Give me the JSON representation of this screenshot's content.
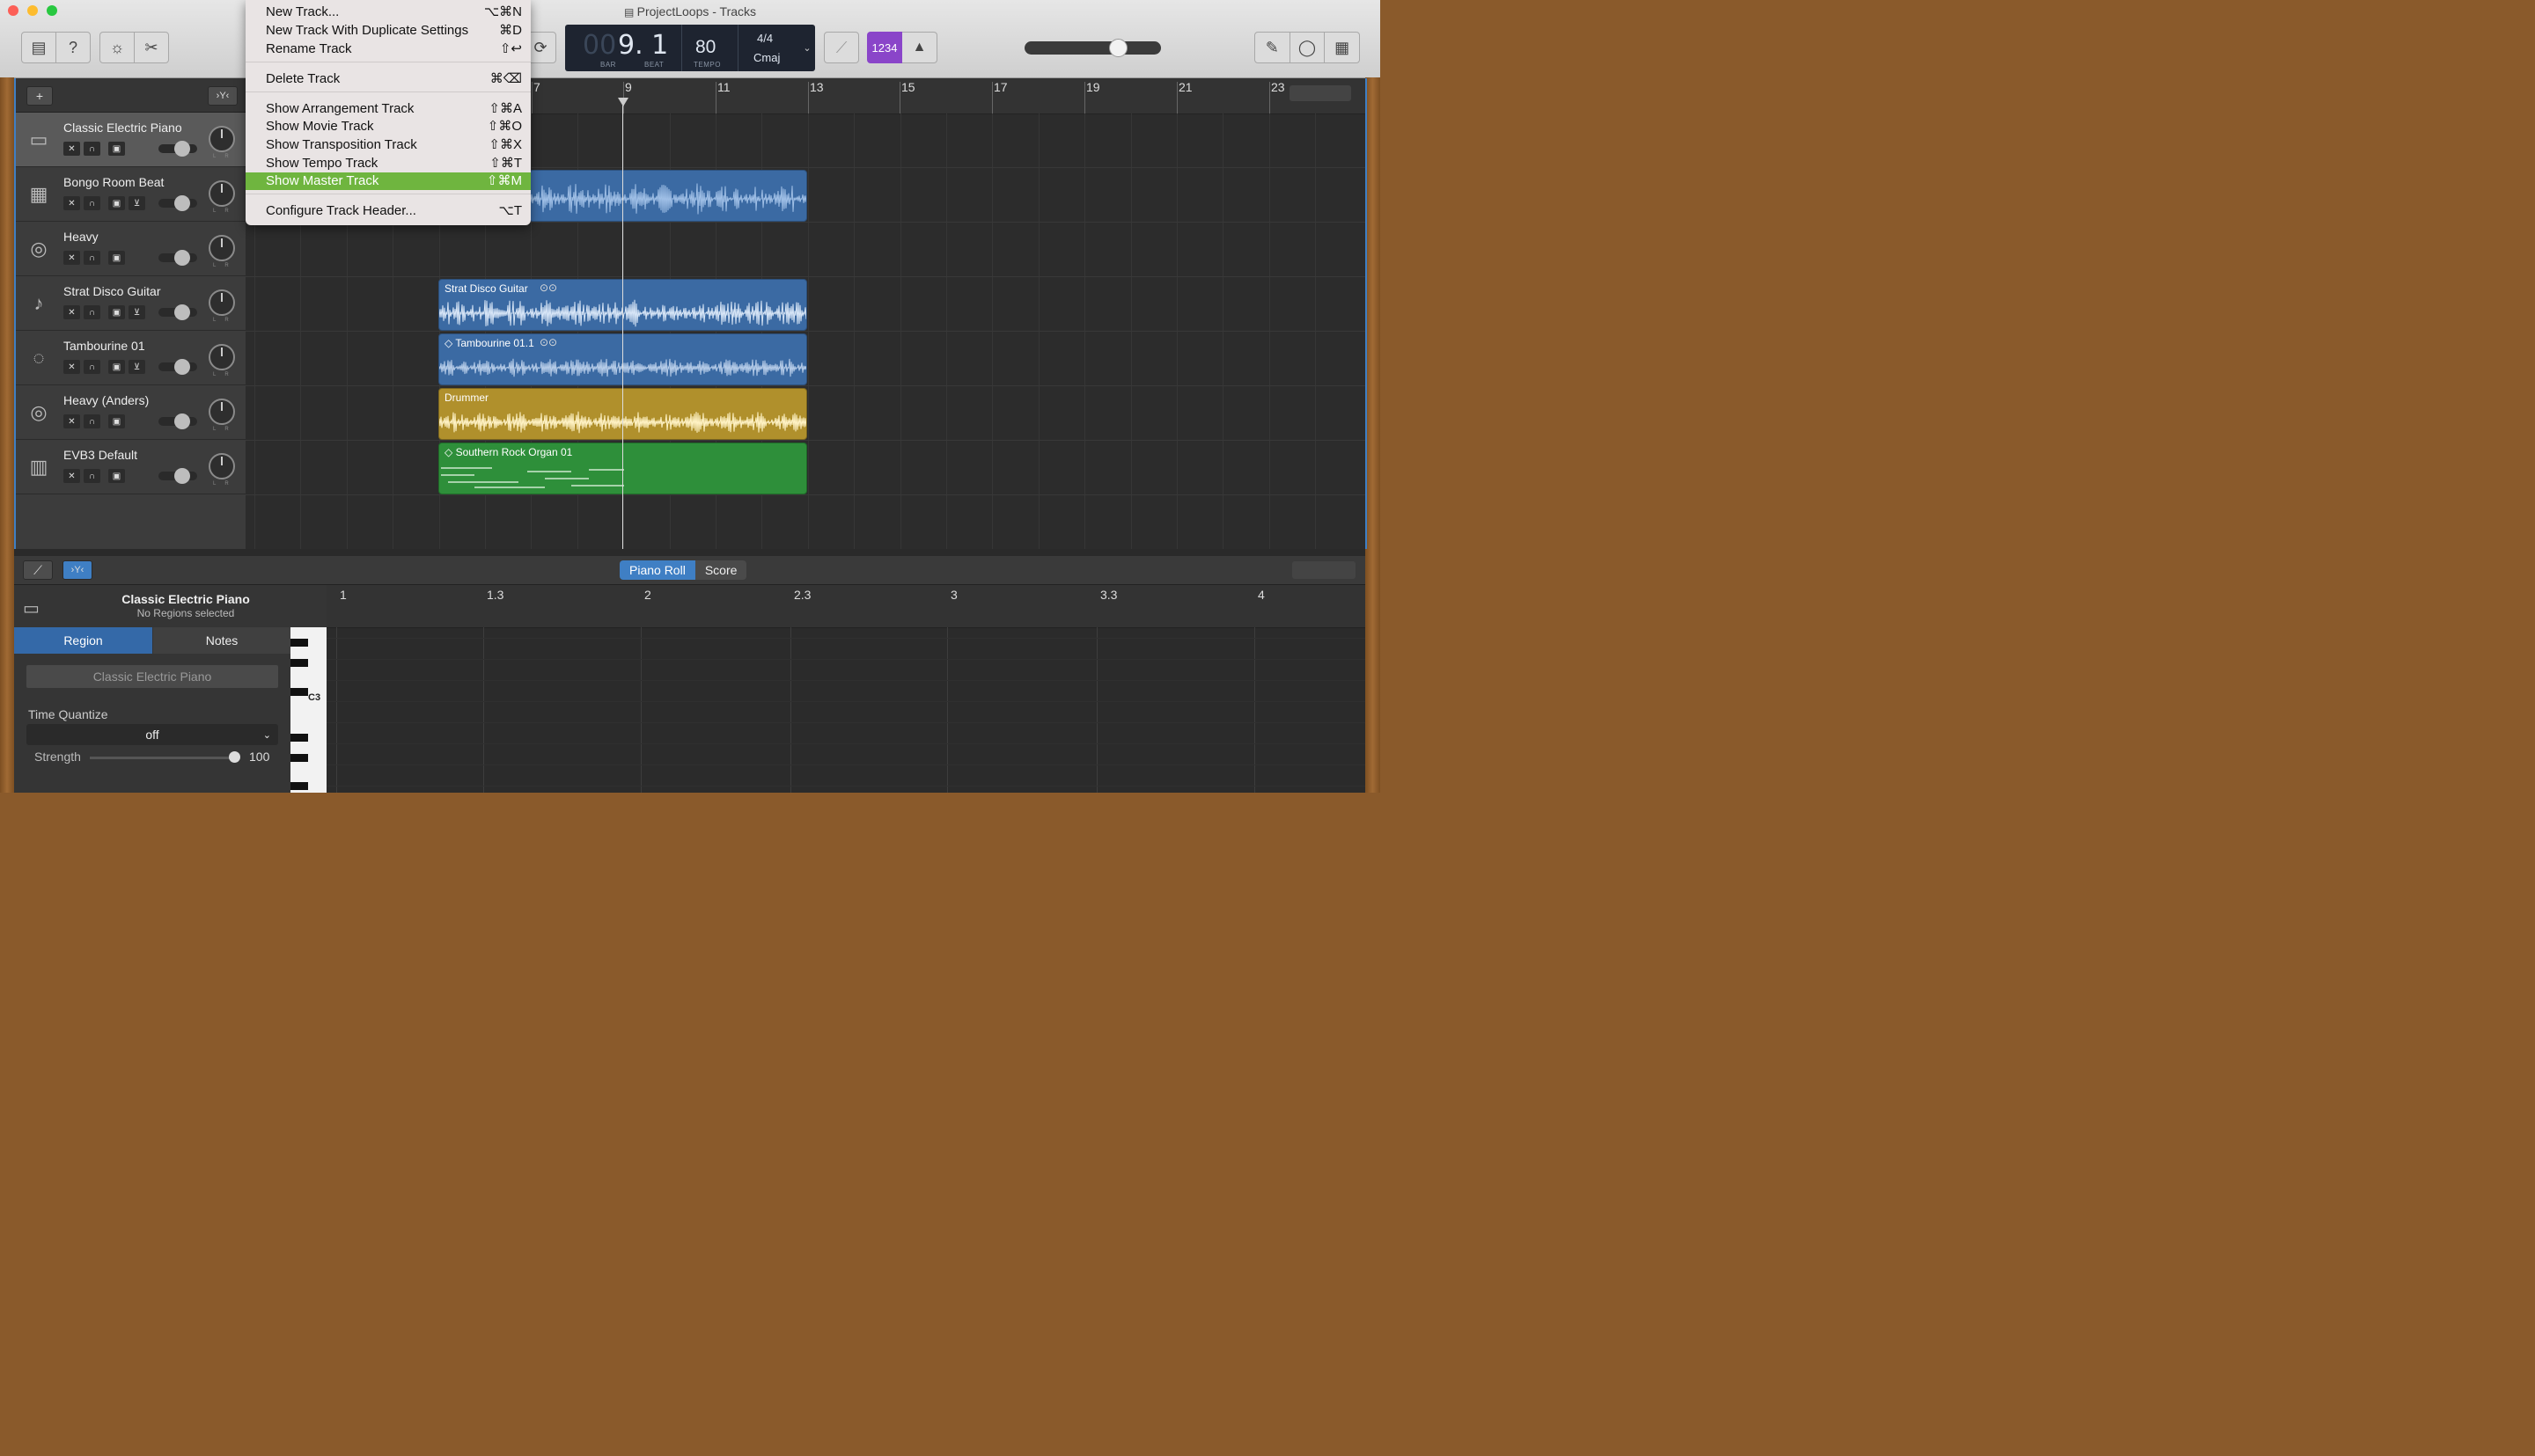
{
  "window": {
    "title": "ProjectLoops - Tracks"
  },
  "menu": {
    "items": [
      {
        "label": "New Track...",
        "shortcut": "⌥⌘N"
      },
      {
        "label": "New Track With Duplicate Settings",
        "shortcut": "⌘D"
      },
      {
        "label": "Rename Track",
        "shortcut": "⇧↩"
      },
      {
        "label": "Delete Track",
        "shortcut": "⌘⌫"
      },
      {
        "label": "Show Arrangement Track",
        "shortcut": "⇧⌘A"
      },
      {
        "label": "Show Movie Track",
        "shortcut": "⇧⌘O"
      },
      {
        "label": "Show Transposition Track",
        "shortcut": "⇧⌘X"
      },
      {
        "label": "Show Tempo Track",
        "shortcut": "⇧⌘T"
      },
      {
        "label": "Show Master Track",
        "shortcut": "⇧⌘M"
      },
      {
        "label": "Configure Track Header...",
        "shortcut": "⌥T"
      }
    ],
    "selected": "Show Master Track"
  },
  "lcd": {
    "bar_dim": "00",
    "position": "9. 1",
    "bar_label": "BAR",
    "beat_label": "BEAT",
    "tempo": "80",
    "tempo_label": "TEMPO",
    "signature": "4/4",
    "key": "Cmaj"
  },
  "toolbar": {
    "count_in": "1234"
  },
  "ruler": {
    "bars": [
      "7",
      "9",
      "11",
      "13",
      "15",
      "17",
      "19",
      "21",
      "23"
    ]
  },
  "tracks": [
    {
      "name": "Classic Electric Piano",
      "icon": "piano-icon",
      "selected": true
    },
    {
      "name": "Bongo Room Beat",
      "icon": "drum-machine-icon",
      "selected": false
    },
    {
      "name": "Heavy",
      "icon": "drum-kit-icon",
      "selected": false
    },
    {
      "name": "Strat Disco Guitar",
      "icon": "guitar-icon",
      "selected": false
    },
    {
      "name": "Tambourine 01",
      "icon": "tambourine-icon",
      "selected": false
    },
    {
      "name": "Heavy (Anders)",
      "icon": "drum-kit-icon",
      "selected": false
    },
    {
      "name": "EVB3 Default",
      "icon": "organ-icon",
      "selected": false
    }
  ],
  "regions": {
    "strat": "Strat Disco Guitar",
    "tambourine": "◇ Tambourine 01.1",
    "drummer": "Drummer",
    "organ": "◇ Southern Rock Organ 01"
  },
  "colors": {
    "audio_region": "#3b6aa3",
    "drummer_region": "#b0902c",
    "midi_region": "#2e8f3a",
    "menu_highlight": "#6fb53f",
    "accent": "#3f7fc4"
  },
  "editor": {
    "tabs": [
      "Piano Roll",
      "Score"
    ],
    "active_tab": "Piano Roll",
    "track_name": "Classic Electric Piano",
    "status": "No Regions selected",
    "inspector_tabs": [
      "Region",
      "Notes"
    ],
    "region_name": "Classic Electric Piano",
    "time_quantize_label": "Time Quantize",
    "time_quantize_value": "off",
    "strength_label": "Strength",
    "strength_value": "100",
    "key_label": "C3",
    "ruler": [
      "1",
      "1.3",
      "2",
      "2.3",
      "3",
      "3.3",
      "4"
    ]
  }
}
